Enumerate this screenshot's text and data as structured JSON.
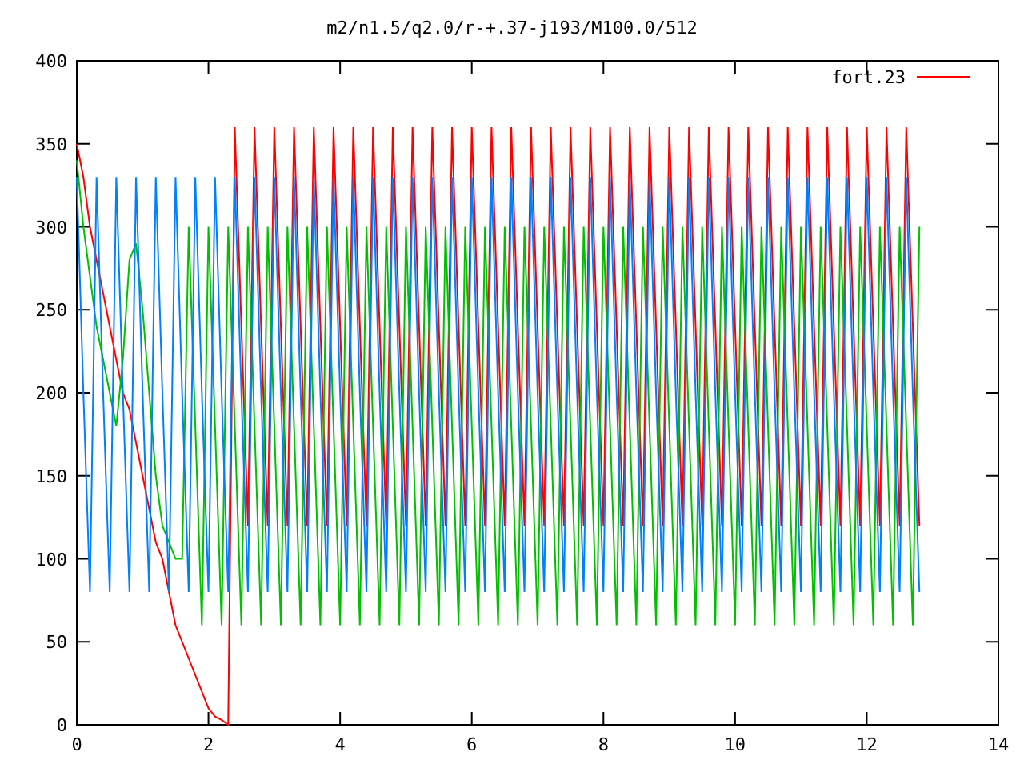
{
  "chart": {
    "chart_data": {
      "type": "line",
      "title": "m2/n1.5/q2.0/r-+.37-j193/M100.0/512",
      "x": [
        0,
        0.1,
        0.2,
        0.3,
        0.4,
        0.5,
        0.6,
        0.7,
        0.8,
        0.9,
        1,
        1.1,
        1.2,
        1.3,
        1.4,
        1.5,
        1.6,
        1.7,
        1.8,
        1.9,
        2,
        2.1,
        2.2,
        2.3,
        2.4,
        2.5,
        2.6,
        2.7,
        2.8,
        2.9,
        3,
        3.1,
        3.2,
        3.3,
        3.4,
        3.5,
        3.6,
        3.7,
        3.8,
        3.9,
        4,
        4.1,
        4.2,
        4.3,
        4.4,
        4.5,
        4.6,
        4.7,
        4.8,
        4.9,
        5,
        5.1,
        5.2,
        5.3,
        5.4,
        5.5,
        5.6,
        5.7,
        5.8,
        5.9,
        6,
        6.1,
        6.2,
        6.3,
        6.4,
        6.5,
        6.6,
        6.7,
        6.8,
        6.9,
        7,
        7.1,
        7.2,
        7.3,
        7.4,
        7.5,
        7.6,
        7.7,
        7.8,
        7.9,
        8,
        8.1,
        8.2,
        8.3,
        8.4,
        8.5,
        8.6,
        8.7,
        8.8,
        8.9,
        9,
        9.1,
        9.2,
        9.3,
        9.4,
        9.5,
        9.6,
        9.7,
        9.8,
        9.9,
        10,
        10.1,
        10.2,
        10.3,
        10.4,
        10.5,
        10.6,
        10.7,
        10.8,
        10.9,
        11,
        11.1,
        11.2,
        11.3,
        11.4,
        11.5,
        11.6,
        11.7,
        11.8,
        11.9,
        12,
        12.1,
        12.2,
        12.3,
        12.4,
        12.5,
        12.6,
        12.7,
        12.8
      ],
      "series": [
        {
          "name": "fort.23",
          "color": "#ff0000",
          "values": [
            350,
            330,
            300,
            280,
            260,
            240,
            220,
            200,
            190,
            170,
            150,
            130,
            110,
            100,
            80,
            60,
            50,
            40,
            30,
            20,
            10,
            5,
            3,
            0,
            360,
            240,
            120,
            360,
            240,
            120,
            360,
            240,
            120,
            360,
            240,
            120,
            360,
            240,
            120,
            360,
            240,
            120,
            360,
            240,
            120,
            360,
            240,
            120,
            360,
            240,
            120,
            360,
            240,
            120,
            360,
            240,
            120,
            360,
            240,
            120,
            360,
            240,
            120,
            360,
            240,
            120,
            360,
            240,
            120,
            360,
            240,
            120,
            360,
            240,
            120,
            360,
            240,
            120,
            360,
            240,
            120,
            360,
            240,
            120,
            360,
            240,
            120,
            360,
            240,
            120,
            360,
            240,
            120,
            360,
            240,
            120,
            360,
            240,
            120,
            360,
            240,
            120,
            360,
            240,
            120,
            360,
            240,
            120,
            360,
            240,
            120,
            360,
            240,
            120,
            360,
            240,
            120,
            360,
            240,
            120,
            360,
            240,
            120,
            360,
            240,
            120,
            360,
            240,
            120
          ]
        },
        {
          "color": "#00c000",
          "values": [
            340,
            300,
            270,
            240,
            220,
            200,
            180,
            220,
            280,
            290,
            250,
            200,
            150,
            120,
            110,
            100,
            100,
            300,
            180,
            60,
            300,
            180,
            60,
            300,
            180,
            60,
            300,
            180,
            60,
            300,
            180,
            60,
            300,
            180,
            60,
            300,
            180,
            60,
            300,
            180,
            60,
            300,
            180,
            60,
            300,
            180,
            60,
            300,
            180,
            60,
            300,
            180,
            60,
            300,
            180,
            60,
            300,
            180,
            60,
            300,
            180,
            60,
            300,
            180,
            60,
            300,
            180,
            60,
            300,
            180,
            60,
            300,
            180,
            60,
            300,
            180,
            60,
            300,
            180,
            60,
            300,
            180,
            60,
            300,
            180,
            60,
            300,
            180,
            60,
            300,
            180,
            60,
            300,
            180,
            60,
            300,
            180,
            60,
            300,
            180,
            60,
            300,
            180,
            60,
            300,
            180,
            60,
            300,
            180,
            60,
            300,
            180,
            60,
            300,
            180,
            60,
            300,
            180,
            60,
            300,
            180,
            60,
            300,
            180,
            60,
            300,
            180,
            60,
            300
          ]
        },
        {
          "color": "#0080ff",
          "values": [
            330,
            200,
            80,
            330,
            200,
            80,
            330,
            200,
            80,
            330,
            200,
            80,
            330,
            200,
            80,
            330,
            200,
            80,
            330,
            200,
            80,
            330,
            200,
            80,
            330,
            200,
            80,
            330,
            200,
            80,
            330,
            200,
            80,
            330,
            200,
            80,
            330,
            200,
            80,
            330,
            200,
            80,
            330,
            200,
            80,
            330,
            200,
            80,
            330,
            200,
            80,
            330,
            200,
            80,
            330,
            200,
            80,
            330,
            200,
            80,
            330,
            200,
            80,
            330,
            200,
            80,
            330,
            200,
            80,
            330,
            200,
            80,
            330,
            200,
            80,
            330,
            200,
            80,
            330,
            200,
            80,
            330,
            200,
            80,
            330,
            200,
            80,
            330,
            200,
            80,
            330,
            200,
            80,
            330,
            200,
            80,
            330,
            200,
            80,
            330,
            200,
            80,
            330,
            200,
            80,
            330,
            200,
            80,
            330,
            200,
            80,
            330,
            200,
            80,
            330,
            200,
            80,
            330,
            200,
            80,
            330,
            200,
            80,
            330,
            200,
            80,
            330,
            200,
            80
          ]
        }
      ],
      "xlim": [
        0,
        14
      ],
      "ylim": [
        0,
        400
      ],
      "xticks": [
        0,
        2,
        4,
        6,
        8,
        10,
        12,
        14
      ],
      "yticks": [
        0,
        50,
        100,
        150,
        200,
        250,
        300,
        350,
        400
      ]
    }
  }
}
